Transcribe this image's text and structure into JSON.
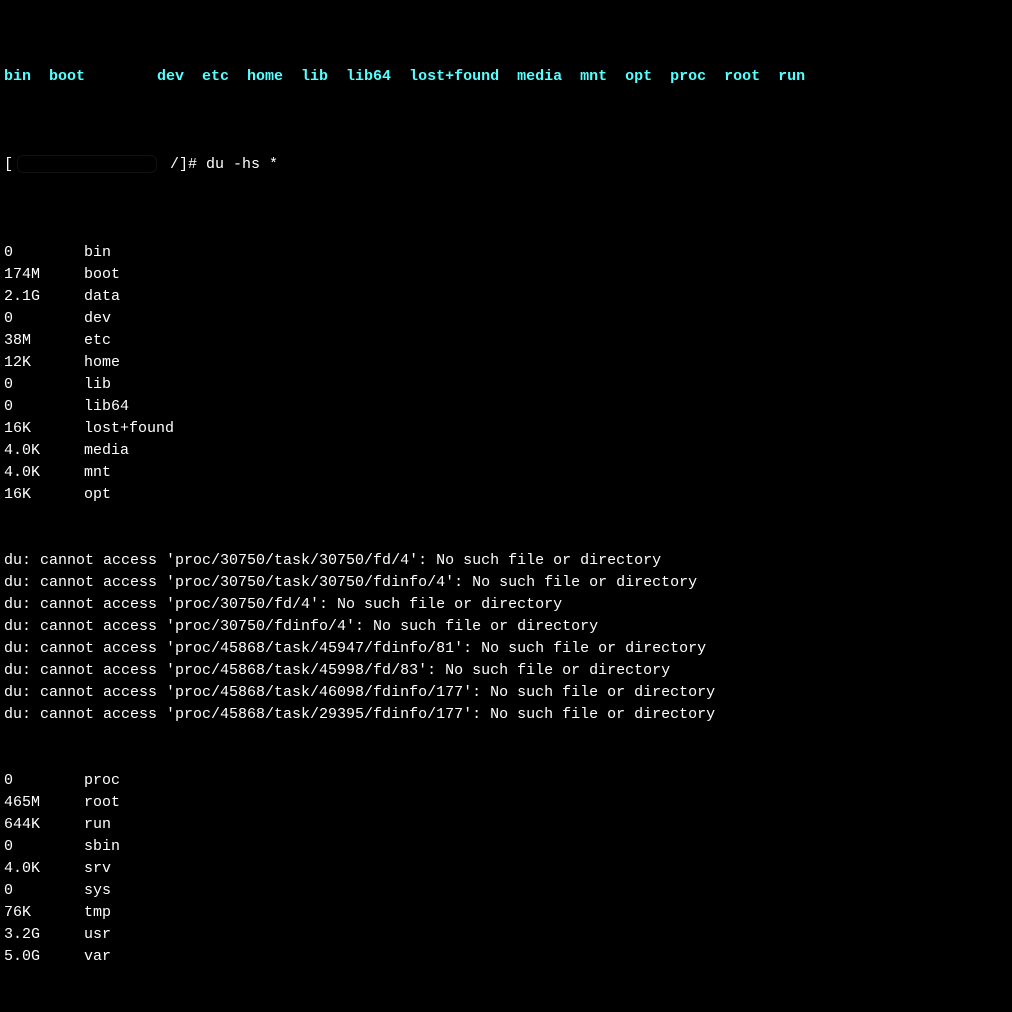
{
  "topbar": {
    "dirs": "bin  boot        dev  etc  home  lib  lib64  lost+found  media  mnt  opt  proc  root  run  "
  },
  "prompt": {
    "prefix": "[",
    "suffix": " /]# ",
    "cmd": "du -hs *"
  },
  "rows1": [
    {
      "size": "0",
      "name": "bin"
    },
    {
      "size": "174M",
      "name": "boot"
    },
    {
      "size": "2.1G",
      "name": "data"
    },
    {
      "size": "0",
      "name": "dev"
    },
    {
      "size": "38M",
      "name": "etc"
    },
    {
      "size": "12K",
      "name": "home"
    },
    {
      "size": "0",
      "name": "lib"
    },
    {
      "size": "0",
      "name": "lib64"
    },
    {
      "size": "16K",
      "name": "lost+found"
    },
    {
      "size": "4.0K",
      "name": "media"
    },
    {
      "size": "4.0K",
      "name": "mnt"
    },
    {
      "size": "16K",
      "name": "opt"
    }
  ],
  "errors": [
    "du: cannot access 'proc/30750/task/30750/fd/4': No such file or directory",
    "du: cannot access 'proc/30750/task/30750/fdinfo/4': No such file or directory",
    "du: cannot access 'proc/30750/fd/4': No such file or directory",
    "du: cannot access 'proc/30750/fdinfo/4': No such file or directory",
    "du: cannot access 'proc/45868/task/45947/fdinfo/81': No such file or directory",
    "du: cannot access 'proc/45868/task/45998/fd/83': No such file or directory",
    "du: cannot access 'proc/45868/task/46098/fdinfo/177': No such file or directory",
    "du: cannot access 'proc/45868/task/29395/fdinfo/177': No such file or directory"
  ],
  "rows2": [
    {
      "size": "0",
      "name": "proc"
    },
    {
      "size": "465M",
      "name": "root"
    },
    {
      "size": "644K",
      "name": "run"
    },
    {
      "size": "0",
      "name": "sbin"
    },
    {
      "size": "4.0K",
      "name": "srv"
    },
    {
      "size": "0",
      "name": "sys"
    },
    {
      "size": "76K",
      "name": "tmp"
    },
    {
      "size": "3.2G",
      "name": "usr"
    },
    {
      "size": "5.0G",
      "name": "var"
    }
  ]
}
